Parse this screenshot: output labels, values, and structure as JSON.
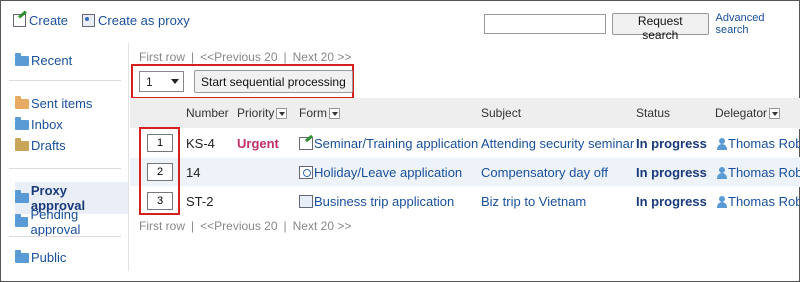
{
  "toolbar": {
    "create_label": "Create",
    "create_proxy_label": "Create as proxy"
  },
  "search": {
    "value": "",
    "button_label": "Request search",
    "advanced_label": "Advanced search"
  },
  "sidebar": {
    "items": [
      {
        "label": "Recent"
      },
      {
        "label": "Sent items"
      },
      {
        "label": "Inbox"
      },
      {
        "label": "Drafts"
      },
      {
        "label": "Proxy approval"
      },
      {
        "label": "Pending approval"
      },
      {
        "label": "Public"
      }
    ]
  },
  "pager": {
    "first": "First row",
    "prev": "<<Previous 20",
    "next": "Next 20 >>",
    "sep": "|"
  },
  "actions": {
    "selected_count": "1",
    "start_label": "Start sequential processing"
  },
  "table": {
    "headers": {
      "number": "Number",
      "priority": "Priority",
      "form": "Form",
      "subject": "Subject",
      "status": "Status",
      "delegator": "Delegator"
    },
    "rows": [
      {
        "order": "1",
        "number": "KS-4",
        "priority": "Urgent",
        "form": "Seminar/Training application",
        "form_icon": "pencil-form-icon",
        "subject": "Attending security seminar",
        "status": "In progress",
        "delegator": "Thomas Rob"
      },
      {
        "order": "2",
        "number": "14",
        "priority": "",
        "form": "Holiday/Leave application",
        "form_icon": "clock-form-icon",
        "subject": "Compensatory day off",
        "status": "In progress",
        "delegator": "Thomas Rob"
      },
      {
        "order": "3",
        "number": "ST-2",
        "priority": "",
        "form": "Business trip application",
        "form_icon": "plane-form-icon",
        "subject": "Biz trip to Vietnam",
        "status": "In progress",
        "delegator": "Thomas Rob"
      }
    ]
  },
  "colors": {
    "highlight_box": "#d62020",
    "link": "#1a4f9c",
    "urgent": "#c0306a"
  }
}
